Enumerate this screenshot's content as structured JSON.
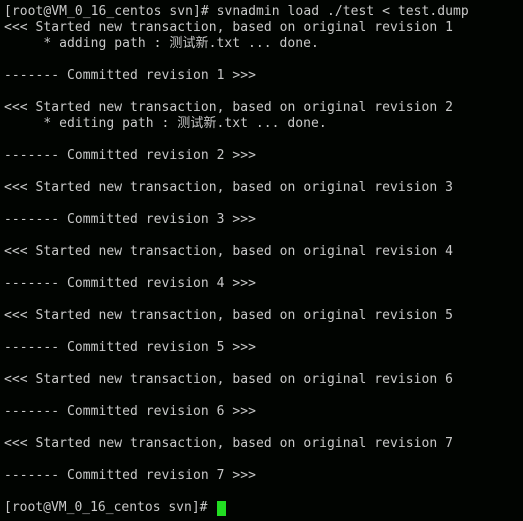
{
  "terminal": {
    "background_color": "#010401",
    "text_color": "#c9c9c9",
    "cursor_color": "#22dd22",
    "prompt": "[root@VM_0_16_centos svn]#",
    "command": " svnadmin load ./test < test.dump",
    "lines": [
      {
        "id": "l1",
        "type": "command",
        "text": "[root@VM_0_16_centos svn]# svnadmin load ./test < test.dump"
      },
      {
        "id": "l2",
        "type": "output",
        "text": "<<< Started new transaction, based on original revision 1"
      },
      {
        "id": "l3",
        "type": "output_cjk",
        "prefix": "     * adding path : ",
        "cjk": "测试新",
        "suffix": ".txt ... done."
      },
      {
        "id": "l4",
        "type": "blank",
        "text": ""
      },
      {
        "id": "l5",
        "type": "output",
        "text": "------- Committed revision 1 >>>"
      },
      {
        "id": "l6",
        "type": "blank",
        "text": ""
      },
      {
        "id": "l7",
        "type": "output",
        "text": "<<< Started new transaction, based on original revision 2"
      },
      {
        "id": "l8",
        "type": "output_cjk",
        "prefix": "     * editing path : ",
        "cjk": "测试新",
        "suffix": ".txt ... done."
      },
      {
        "id": "l9",
        "type": "blank",
        "text": ""
      },
      {
        "id": "l10",
        "type": "output",
        "text": "------- Committed revision 2 >>>"
      },
      {
        "id": "l11",
        "type": "blank",
        "text": ""
      },
      {
        "id": "l12",
        "type": "output",
        "text": "<<< Started new transaction, based on original revision 3"
      },
      {
        "id": "l13",
        "type": "blank",
        "text": ""
      },
      {
        "id": "l14",
        "type": "output",
        "text": "------- Committed revision 3 >>>"
      },
      {
        "id": "l15",
        "type": "blank",
        "text": ""
      },
      {
        "id": "l16",
        "type": "output",
        "text": "<<< Started new transaction, based on original revision 4"
      },
      {
        "id": "l17",
        "type": "blank",
        "text": ""
      },
      {
        "id": "l18",
        "type": "output",
        "text": "------- Committed revision 4 >>>"
      },
      {
        "id": "l19",
        "type": "blank",
        "text": ""
      },
      {
        "id": "l20",
        "type": "output",
        "text": "<<< Started new transaction, based on original revision 5"
      },
      {
        "id": "l21",
        "type": "blank",
        "text": ""
      },
      {
        "id": "l22",
        "type": "output",
        "text": "------- Committed revision 5 >>>"
      },
      {
        "id": "l23",
        "type": "blank",
        "text": ""
      },
      {
        "id": "l24",
        "type": "output",
        "text": "<<< Started new transaction, based on original revision 6"
      },
      {
        "id": "l25",
        "type": "blank",
        "text": ""
      },
      {
        "id": "l26",
        "type": "output",
        "text": "------- Committed revision 6 >>>"
      },
      {
        "id": "l27",
        "type": "blank",
        "text": ""
      },
      {
        "id": "l28",
        "type": "output",
        "text": "<<< Started new transaction, based on original revision 7"
      },
      {
        "id": "l29",
        "type": "blank",
        "text": ""
      },
      {
        "id": "l30",
        "type": "output",
        "text": "------- Committed revision 7 >>>"
      },
      {
        "id": "l31",
        "type": "blank",
        "text": ""
      },
      {
        "id": "l32",
        "type": "prompt",
        "text": "[root@VM_0_16_centos svn]# "
      }
    ]
  }
}
